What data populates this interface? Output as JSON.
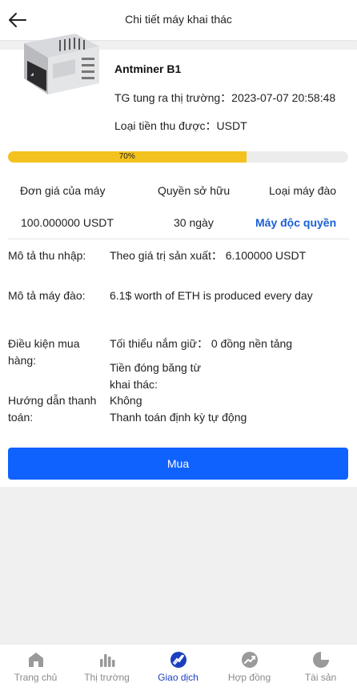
{
  "header": {
    "title": "Chi tiết máy khai thác"
  },
  "product": {
    "name": "Antminer B1",
    "release_label": "TG tung ra thị trường：",
    "release_value": "2023-07-07 20:58:48",
    "currency_label": "Loại tiền thu được：",
    "currency_value": "USDT"
  },
  "progress": {
    "percent": 70,
    "text": "70%"
  },
  "info": {
    "price_label": "Đơn giá của máy",
    "price_value": "100.000000 USDT",
    "ownership_label": "Quyền sở hữu",
    "ownership_value": "30 ngày",
    "type_label": "Loại máy đào",
    "type_value": "Máy độc quyền"
  },
  "details": {
    "income_label": "Mô tả thu nhập:",
    "income_value": "Theo giá trị sản xuất： 6.100000 USDT",
    "machine_label": "Mô tả máy đào:",
    "machine_value": "6.1$ worth of ETH is produced every day",
    "purchase_label_1": "Điều kiện mua",
    "purchase_label_2": "hàng:",
    "min_hold": "Tối thiểu nắm giữ： 0 đồng nền tảng",
    "freeze_line_1": "Tiền đóng băng từ",
    "freeze_line_2": "khai thác:",
    "freeze_value": "Không",
    "payment_label_1": "Hướng dẫn thanh",
    "payment_label_2": "toán:",
    "payment_value": "Thanh toán định kỳ tự động"
  },
  "buy_button": "Mua",
  "tabs": [
    {
      "label": "Trang chủ",
      "icon": "home-icon"
    },
    {
      "label": "Thị trường",
      "icon": "market-icon"
    },
    {
      "label": "Giao dịch",
      "icon": "trade-icon",
      "active": true
    },
    {
      "label": "Hợp đồng",
      "icon": "contract-icon"
    },
    {
      "label": "Tài sản",
      "icon": "assets-icon"
    }
  ],
  "colors": {
    "accent": "#1062fe",
    "progress": "#f4c21f",
    "link": "#1a5fd6",
    "tab_active": "#1a3fbf",
    "tab_inactive": "#9a9a9a"
  }
}
